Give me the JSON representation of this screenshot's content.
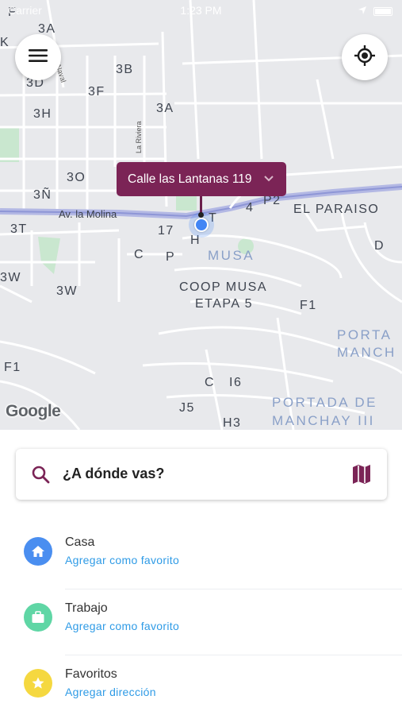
{
  "status_bar": {
    "carrier": "Carrier",
    "time": "1:23 PM"
  },
  "map": {
    "current_address": "Calle las Lantanas 119",
    "streets": [
      "Av. la Molina",
      "La Riviera",
      "Naval"
    ],
    "areas": [
      "MUSA",
      "COOP MUSA",
      "ETAPA 5",
      "EL PARAISO",
      "PORTA",
      "MANCH",
      "PORTADA DE",
      "MANCHAY III"
    ],
    "blocks": [
      "3A",
      "3B",
      "3D",
      "3F",
      "3A",
      "3H",
      "3O",
      "3Ñ",
      "3T",
      "3W",
      "3W",
      "4",
      "P2",
      "17",
      "T",
      "H",
      "C",
      "P",
      "D",
      "F1",
      "F1",
      "C",
      "I6",
      "J5",
      "H3",
      "K",
      "F"
    ],
    "attribution": "Google"
  },
  "search": {
    "placeholder": "¿A dónde vas?"
  },
  "favorites": [
    {
      "title": "Casa",
      "action": "Agregar como favorito",
      "icon": "home-icon",
      "color": "#4a8ef0"
    },
    {
      "title": "Trabajo",
      "action": "Agregar como favorito",
      "icon": "briefcase-icon",
      "color": "#5fd6a5"
    },
    {
      "title": "Favoritos",
      "action": "Agregar dirección",
      "icon": "star-icon",
      "color": "#f5d840"
    }
  ],
  "colors": {
    "accent": "#7b2456",
    "link": "#2f9be6"
  }
}
